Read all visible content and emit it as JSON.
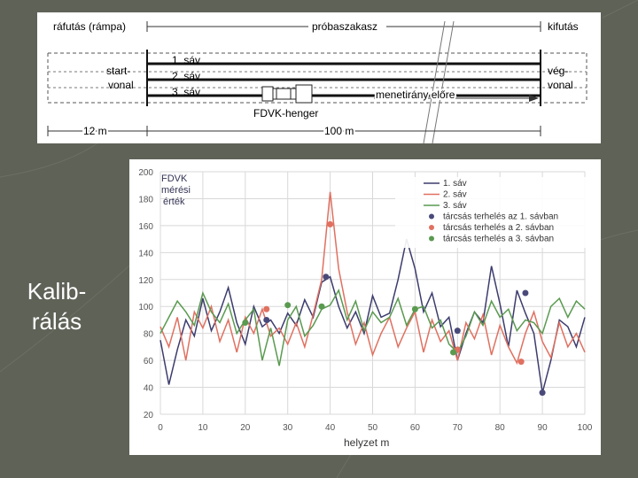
{
  "slide": {
    "title_line1": "Kalib-",
    "title_line2": "rálás"
  },
  "diagram": {
    "ramp_label": "ráfutás (rámpa)",
    "test_section_label": "próbaszakasz",
    "runout_label": "kifutás",
    "start_line_1": "start-",
    "start_line_2": "vonal",
    "end_line_1": "vég-",
    "end_line_2": "vonal",
    "lane_1": "1. sáv",
    "lane_2": "2. sáv",
    "lane_3": "3. sáv",
    "direction_label": "menetirány előre",
    "cylinder_label": "FDVK-henger",
    "ramp_length": "12 m",
    "section_length": "100 m"
  },
  "chart_data": {
    "type": "line",
    "annotation_1": "FDVK",
    "annotation_2": "mérési",
    "annotation_3": "érték",
    "xlabel": "helyzet  m",
    "ylabel": "",
    "xlim": [
      0,
      100
    ],
    "ylim": [
      20,
      200
    ],
    "xticks": [
      0,
      10,
      20,
      30,
      40,
      50,
      60,
      70,
      80,
      90,
      100
    ],
    "yticks": [
      20,
      40,
      60,
      80,
      100,
      120,
      140,
      160,
      180,
      200
    ],
    "legend_position": "top-right",
    "series": [
      {
        "name": "1. sáv",
        "color": "#3c3c6e",
        "x": [
          0,
          2,
          4,
          6,
          8,
          10,
          12,
          14,
          16,
          18,
          20,
          22,
          24,
          26,
          28,
          30,
          32,
          34,
          36,
          38,
          40,
          42,
          44,
          46,
          48,
          50,
          52,
          54,
          56,
          58,
          60,
          62,
          64,
          66,
          68,
          70,
          72,
          74,
          76,
          78,
          80,
          82,
          84,
          86,
          88,
          90,
          92,
          94,
          96,
          98,
          100
        ],
        "y": [
          75,
          42,
          68,
          90,
          78,
          106,
          82,
          96,
          114,
          88,
          72,
          100,
          85,
          90,
          80,
          95,
          86,
          105,
          92,
          118,
          122,
          100,
          84,
          96,
          80,
          108,
          92,
          95,
          120,
          150,
          128,
          96,
          110,
          85,
          92,
          60,
          80,
          96,
          88,
          130,
          102,
          70,
          112,
          95,
          80,
          36,
          60,
          90,
          85,
          70,
          92
        ]
      },
      {
        "name": "2. sáv",
        "color": "#e07060",
        "x": [
          0,
          2,
          4,
          6,
          8,
          10,
          12,
          14,
          16,
          18,
          20,
          22,
          24,
          26,
          28,
          30,
          32,
          34,
          36,
          38,
          40,
          42,
          44,
          46,
          48,
          50,
          52,
          54,
          56,
          58,
          60,
          62,
          64,
          66,
          68,
          70,
          72,
          74,
          76,
          78,
          80,
          82,
          84,
          86,
          88,
          90,
          92,
          94,
          96,
          98,
          100
        ],
        "y": [
          85,
          70,
          92,
          60,
          96,
          84,
          100,
          74,
          90,
          66,
          92,
          80,
          98,
          78,
          84,
          72,
          88,
          70,
          94,
          120,
          185,
          128,
          96,
          72,
          88,
          64,
          80,
          92,
          70,
          84,
          96,
          66,
          90,
          74,
          82,
          60,
          88,
          76,
          94,
          64,
          86,
          70,
          58,
          80,
          96,
          74,
          62,
          88,
          70,
          80,
          66
        ]
      },
      {
        "name": "3. sáv",
        "color": "#5a9a50",
        "x": [
          0,
          2,
          4,
          6,
          8,
          10,
          12,
          14,
          16,
          18,
          20,
          22,
          24,
          26,
          28,
          30,
          32,
          34,
          36,
          38,
          40,
          42,
          44,
          46,
          48,
          50,
          52,
          54,
          56,
          58,
          60,
          62,
          64,
          66,
          68,
          70,
          72,
          74,
          76,
          78,
          80,
          82,
          84,
          86,
          88,
          90,
          92,
          94,
          96,
          98,
          100
        ],
        "y": [
          80,
          92,
          104,
          96,
          86,
          110,
          96,
          88,
          102,
          80,
          90,
          98,
          60,
          84,
          56,
          90,
          100,
          78,
          86,
          98,
          101,
          112,
          90,
          104,
          82,
          96,
          88,
          92,
          106,
          86,
          98,
          100,
          84,
          90,
          72,
          66,
          78,
          96,
          86,
          104,
          92,
          98,
          82,
          90,
          88,
          80,
          100,
          106,
          92,
          104,
          98
        ]
      }
    ],
    "markers": [
      {
        "name": "tárcsás terhelés az 1. sávban",
        "color": "#4a4a7a",
        "points": [
          [
            25,
            90
          ],
          [
            39,
            122
          ],
          [
            70,
            82
          ],
          [
            86,
            110
          ],
          [
            90,
            36
          ]
        ]
      },
      {
        "name": "tárcsás terhelés a  2. sávban",
        "color": "#e07060",
        "points": [
          [
            25,
            98
          ],
          [
            40,
            161
          ],
          [
            70,
            68
          ],
          [
            85,
            59
          ]
        ]
      },
      {
        "name": "tárcsás terhelés a  3. sávban",
        "color": "#5a9a50",
        "points": [
          [
            20,
            88
          ],
          [
            30,
            101
          ],
          [
            38,
            100
          ],
          [
            60,
            98
          ],
          [
            69,
            66
          ]
        ]
      }
    ]
  }
}
